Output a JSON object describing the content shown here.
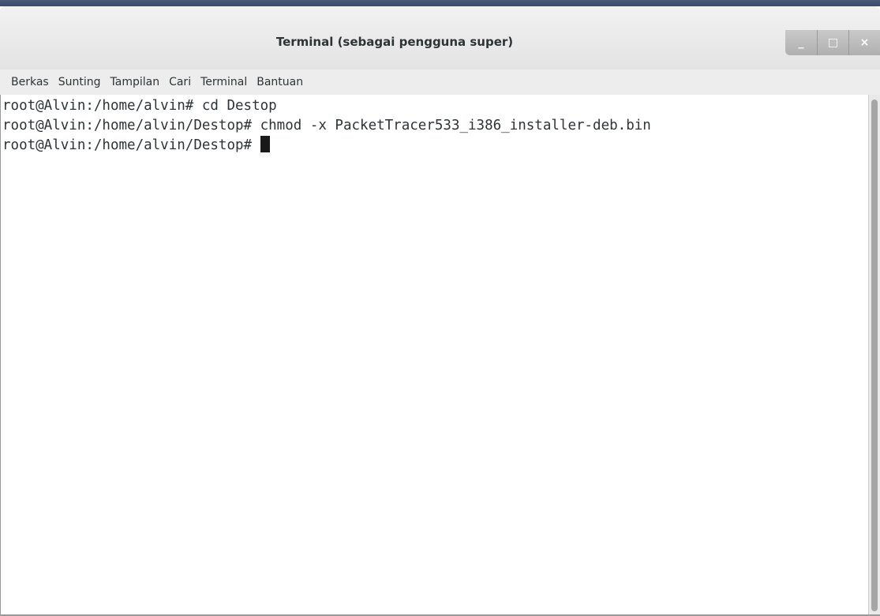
{
  "window": {
    "title": "Terminal (sebagai pengguna super)",
    "controls": {
      "minimize": "_",
      "maximize": "□",
      "close": "×"
    }
  },
  "menubar": {
    "items": [
      {
        "label": "Berkas"
      },
      {
        "label": "Sunting"
      },
      {
        "label": "Tampilan"
      },
      {
        "label": "Cari"
      },
      {
        "label": "Terminal"
      },
      {
        "label": "Bantuan"
      }
    ]
  },
  "terminal": {
    "lines": [
      "root@Alvin:/home/alvin# cd Destop",
      "root@Alvin:/home/alvin/Destop# chmod -x PacketTracer533_i386_installer-deb.bin"
    ],
    "prompt": "root@Alvin:/home/alvin/Destop# "
  },
  "colors": {
    "text": "#2e3436",
    "background": "#ffffff",
    "menubar": "#ededed",
    "titlebar": "#e3e3e3"
  }
}
